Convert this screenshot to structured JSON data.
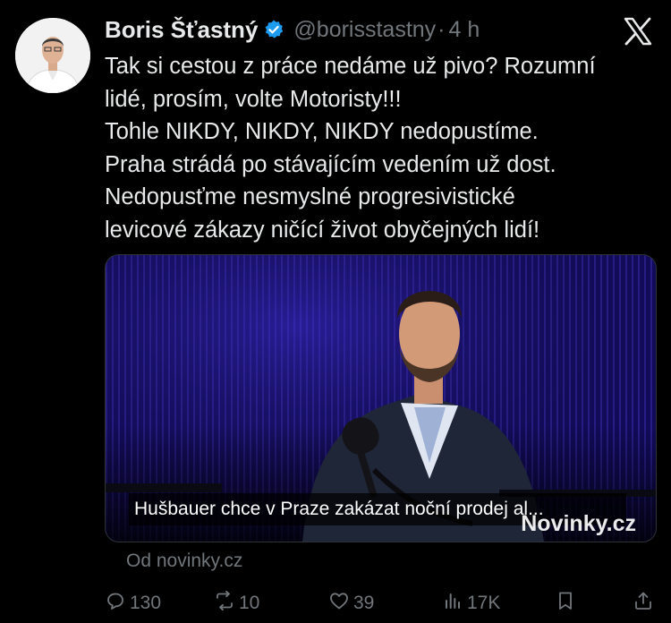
{
  "author": {
    "name": "Boris Šťastný",
    "handle": "@borisstastny",
    "separator": "·",
    "time": "4 h"
  },
  "tweet": {
    "lines": [
      "Tak si cestou z práce nedáme už pivo? Rozumní",
      "lidé, prosím, volte Motoristy!!!",
      "Tohle NIKDY, NIKDY, NIKDY nedopustíme.",
      "Praha strádá po stávajícím vedením už dost.",
      "Nedopusťme nesmyslné progresivistické",
      "levicové zákazy ničící život obyčejných lidí!"
    ]
  },
  "media": {
    "caption": "Hušbauer chce v Praze zakázat noční prodej al...",
    "watermark": "Novinky.cz"
  },
  "source": "Od novinky.cz",
  "actions": {
    "replies": "130",
    "reposts": "10",
    "likes": "39",
    "views": "17K"
  },
  "colors": {
    "background": "#000000",
    "text": "#e7e9ea",
    "muted": "#71767b",
    "verified": "#1d9bf0"
  },
  "icons": [
    "x-logo-icon",
    "verified-badge-icon",
    "reply-icon",
    "repost-icon",
    "like-icon",
    "views-icon",
    "bookmark-icon",
    "share-icon"
  ]
}
